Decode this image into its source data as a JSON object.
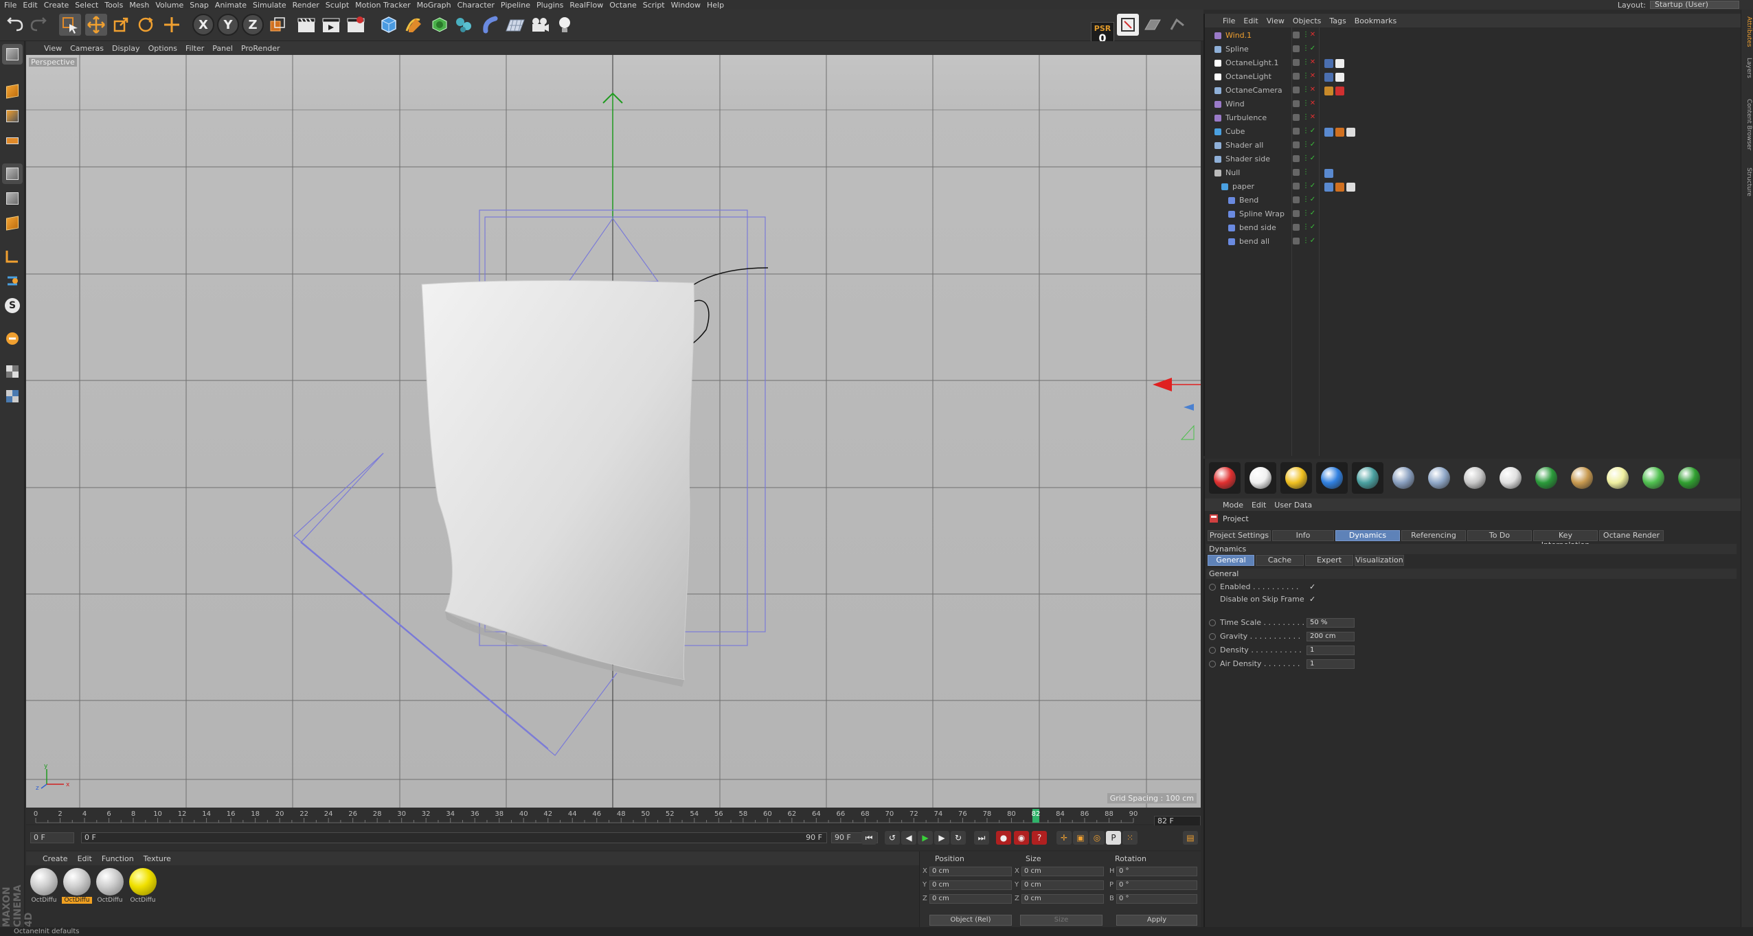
{
  "menubar": {
    "items": [
      "File",
      "Edit",
      "Create",
      "Select",
      "Tools",
      "Mesh",
      "Volume",
      "Snap",
      "Animate",
      "Simulate",
      "Render",
      "Sculpt",
      "Motion Tracker",
      "MoGraph",
      "Character",
      "Pipeline",
      "Plugins",
      "RealFlow",
      "Octane",
      "Script",
      "Window",
      "Help"
    ],
    "layout_label": "Layout:",
    "layout_value": "Startup (User)"
  },
  "toolbar": {
    "axis_x": "X",
    "axis_y": "Y",
    "axis_z": "Z",
    "psr_label": "PSR",
    "psr_value": "0"
  },
  "viewport": {
    "menu": [
      "View",
      "Cameras",
      "Display",
      "Options",
      "Filter",
      "Panel",
      "ProRender"
    ],
    "label": "Perspective",
    "grid_spacing": "Grid Spacing : 100 cm"
  },
  "timeline": {
    "ticks": [
      "0",
      "2",
      "4",
      "6",
      "8",
      "10",
      "12",
      "14",
      "16",
      "18",
      "20",
      "22",
      "24",
      "26",
      "28",
      "30",
      "32",
      "34",
      "36",
      "38",
      "40",
      "42",
      "44",
      "46",
      "48",
      "50",
      "52",
      "54",
      "56",
      "58",
      "60",
      "62",
      "64",
      "66",
      "68",
      "70",
      "72",
      "74",
      "76",
      "78",
      "80",
      "82",
      "84",
      "86",
      "88",
      "90"
    ],
    "current_frame": "82",
    "current_frame_box": "82 F",
    "start_field": "0 F",
    "range_start": "0 F",
    "range_end": "90 F",
    "end_field": "90 F"
  },
  "materials": {
    "menu": [
      "Create",
      "Edit",
      "Function",
      "Texture"
    ],
    "items": [
      {
        "label": "OctDiffu",
        "selected": false,
        "color": "white"
      },
      {
        "label": "OctDiffu",
        "selected": true,
        "color": "white"
      },
      {
        "label": "OctDiffu",
        "selected": false,
        "color": "white"
      },
      {
        "label": "OctDiffu",
        "selected": false,
        "color": "yellow"
      }
    ]
  },
  "brand": "MAXON CINEMA 4D",
  "coordinates": {
    "position_label": "Position",
    "size_label": "Size",
    "rotation_label": "Rotation",
    "rows": [
      {
        "axis": "X",
        "pos": "0 cm",
        "size_axis": "X",
        "size": "0 cm",
        "rot_axis": "H",
        "rot": "0 °"
      },
      {
        "axis": "Y",
        "pos": "0 cm",
        "size_axis": "Y",
        "size": "0 cm",
        "rot_axis": "P",
        "rot": "0 °"
      },
      {
        "axis": "Z",
        "pos": "0 cm",
        "size_axis": "Z",
        "size": "0 cm",
        "rot_axis": "B",
        "rot": "0 °"
      }
    ],
    "mode_select": "Object (Rel)",
    "size_select": "Size",
    "apply_label": "Apply"
  },
  "status": "OctaneInit defaults",
  "object_manager": {
    "menu": [
      "File",
      "Edit",
      "View",
      "Objects",
      "Tags",
      "Bookmarks"
    ],
    "objects": [
      {
        "name": "Wind.1",
        "selected": true,
        "indent": 0,
        "icon_color": "#9a7ac8",
        "status": "x",
        "tags": []
      },
      {
        "name": "Spline",
        "selected": false,
        "indent": 0,
        "icon_color": "#8fb0d8",
        "status": "check",
        "tags": []
      },
      {
        "name": "OctaneLight.1",
        "selected": false,
        "indent": 0,
        "icon_color": "#ffffff",
        "status": "x",
        "tags": [
          "#4b6fb0",
          "#eeeeee"
        ]
      },
      {
        "name": "OctaneLight",
        "selected": false,
        "indent": 0,
        "icon_color": "#ffffff",
        "status": "x",
        "tags": [
          "#4b6fb0",
          "#eeeeee"
        ]
      },
      {
        "name": "OctaneCamera",
        "selected": false,
        "indent": 0,
        "icon_color": "#8fb0d8",
        "status": "x",
        "tags": [
          "#c88a2a",
          "#d03030"
        ]
      },
      {
        "name": "Wind",
        "selected": false,
        "indent": 0,
        "icon_color": "#9a7ac8",
        "status": "x",
        "tags": []
      },
      {
        "name": "Turbulence",
        "selected": false,
        "indent": 0,
        "icon_color": "#9a7ac8",
        "status": "x",
        "tags": []
      },
      {
        "name": "Cube",
        "selected": false,
        "indent": 0,
        "icon_color": "#4aa0e0",
        "status": "check",
        "tags": [
          "#5a8ad0",
          "#d07020",
          "#dddddd"
        ]
      },
      {
        "name": "Shader all",
        "selected": false,
        "indent": 0,
        "icon_color": "#8fb0d8",
        "status": "check",
        "tags": []
      },
      {
        "name": "Shader side",
        "selected": false,
        "indent": 0,
        "icon_color": "#8fb0d8",
        "status": "check",
        "tags": []
      },
      {
        "name": "Null",
        "selected": false,
        "indent": 0,
        "icon_color": "#bbbbbb",
        "status": "none",
        "tags": [
          "#5a8ad0"
        ]
      },
      {
        "name": "paper",
        "selected": false,
        "indent": 1,
        "icon_color": "#4aa0e0",
        "status": "check",
        "tags": [
          "#5a8ad0",
          "#d07020",
          "#dddddd"
        ]
      },
      {
        "name": "Bend",
        "selected": false,
        "indent": 2,
        "icon_color": "#6a8ae0",
        "status": "check",
        "tags": []
      },
      {
        "name": "Spline Wrap",
        "selected": false,
        "indent": 2,
        "icon_color": "#6a8ae0",
        "status": "check",
        "tags": []
      },
      {
        "name": "bend side",
        "selected": false,
        "indent": 2,
        "icon_color": "#6a8ae0",
        "status": "check",
        "tags": []
      },
      {
        "name": "bend all",
        "selected": false,
        "indent": 2,
        "icon_color": "#6a8ae0",
        "status": "check",
        "tags": []
      }
    ]
  },
  "presets": {
    "colors": [
      "#e03030",
      "#f0f0f0",
      "#f0c020",
      "#3080e0",
      "#4aa0a0",
      "#8aa0c0",
      "#90a8c8",
      "#c8c8c8",
      "#e0e0e0",
      "#2a9a3a",
      "#c89a50",
      "#f0f0a0",
      "#50c050",
      "#30a030"
    ]
  },
  "attribute_manager": {
    "menu": [
      "Mode",
      "Edit",
      "User Data"
    ],
    "title": "Project",
    "tabs": [
      {
        "label": "Project Settings",
        "active": false
      },
      {
        "label": "Info",
        "active": false
      },
      {
        "label": "Dynamics",
        "active": true
      },
      {
        "label": "Referencing",
        "active": false
      },
      {
        "label": "To Do",
        "active": false
      },
      {
        "label": "Key Interpolation",
        "active": false
      },
      {
        "label": "Octane Render",
        "active": false
      }
    ],
    "section_dynamics": "Dynamics",
    "subtabs": [
      {
        "label": "General",
        "active": true
      },
      {
        "label": "Cache",
        "active": false
      },
      {
        "label": "Expert",
        "active": false
      },
      {
        "label": "Visualization",
        "active": false
      }
    ],
    "section_general": "General",
    "checks": [
      {
        "label": "Enabled . . . . . . . . . .",
        "value": "✓"
      },
      {
        "label": "Disable on Skip Frame",
        "value": "✓"
      }
    ],
    "props": [
      {
        "label": "Time Scale . . . . . . . . .",
        "value": "50 %"
      },
      {
        "label": "Gravity . . . . . . . . . . .",
        "value": "200 cm"
      },
      {
        "label": "Density . . . . . . . . . . .",
        "value": "1"
      },
      {
        "label": "Air Density . . . . . . . .",
        "value": "1"
      }
    ]
  },
  "right_tabs": [
    "Attributes",
    "Layers",
    "Content Browser",
    "Structure"
  ]
}
